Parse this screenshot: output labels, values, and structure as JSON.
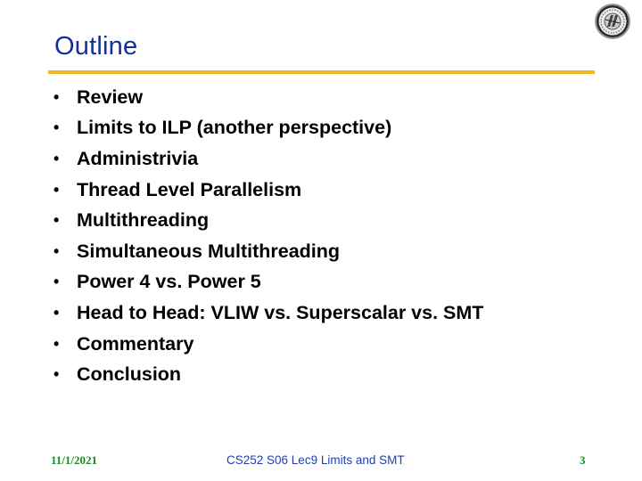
{
  "slide": {
    "title": "Outline",
    "bullets": [
      "Review",
      "Limits to ILP (another perspective)",
      "Administrivia",
      "Thread Level Parallelism",
      "Multithreading",
      "Simultaneous Multithreading",
      "Power 4 vs. Power 5",
      "Head to Head: VLIW vs. Superscalar vs. SMT",
      "Commentary",
      "Conclusion"
    ],
    "bullet_glyph": "•",
    "logo": "university-seal-icon",
    "colors": {
      "title": "#10309a",
      "divider": "#f0b823",
      "footer_date": "#1f8a1f",
      "footer_title": "#1d3fb0",
      "footer_page": "#1f8a1f"
    }
  },
  "footer": {
    "date": "11/1/2021",
    "title": "CS252 S06 Lec9 Limits and SMT",
    "page": "3"
  }
}
